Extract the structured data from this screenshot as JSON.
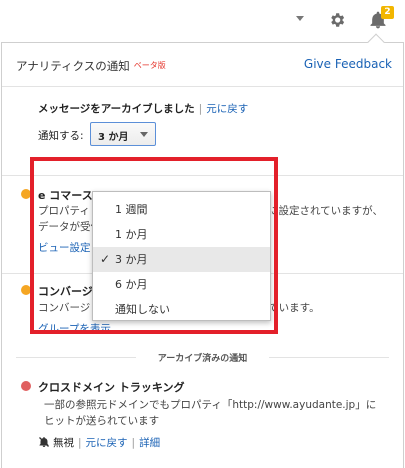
{
  "topbar": {
    "badge_count": "2",
    "icons": [
      "caret-down-icon",
      "gear-icon",
      "bell-icon"
    ]
  },
  "panel": {
    "title": "アナリティクスの通知",
    "beta": "ベータ版",
    "feedback": "Give Feedback"
  },
  "archive_notice": {
    "text": "メッセージをアーカイブしました",
    "separator": "|",
    "undo": "元に戻す"
  },
  "notify": {
    "label": "通知する:",
    "selected": "3 か月",
    "options": [
      "1 週間",
      "1 か月",
      "3 か月",
      "6 か月",
      "通知しない"
    ],
    "selected_index": 2
  },
  "notifications": [
    {
      "title": "e コマース",
      "body_line1": "プロパティ「ヴ",
      "body_line1_tail": "に設定されていますが、",
      "body_line2": "データが受信",
      "link": "ビュー設定",
      "level": "warning"
    },
    {
      "title": "コンバージョンの異常",
      "body": "コンバージョン数がゼロであるか、大幅に減少しています。",
      "link": "グループを表示",
      "level": "warning"
    }
  ],
  "archived_section": {
    "header": "アーカイブ済みの通知",
    "item": {
      "title": "クロスドメイン トラッキング",
      "body_line1": "一部の参照元ドメインでもプロパティ「http://www.ayudante.jp」に",
      "body_line2": "ヒットが送られています",
      "actions": {
        "ignore": "無視",
        "undo": "元に戻す",
        "details": "詳細",
        "sep": "|"
      },
      "level": "error"
    }
  },
  "colors": {
    "link": "#1a62b5",
    "highlight_box": "#e3202a",
    "warning": "#f5a623",
    "error": "#e06060",
    "badge": "#f2b600"
  }
}
